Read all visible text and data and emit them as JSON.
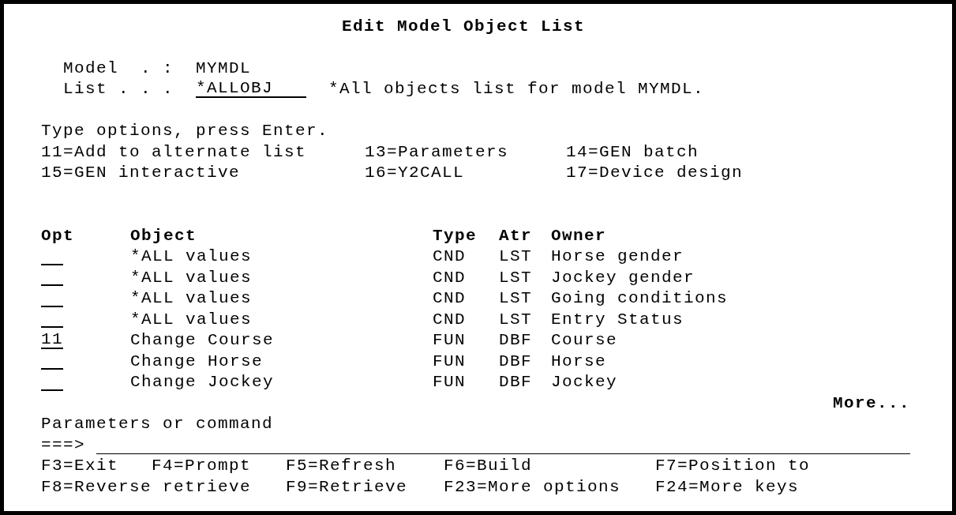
{
  "title": "Edit Model Object List",
  "header_fields": [
    {
      "kind": "output",
      "label": "Model  . :",
      "value": "MYMDL"
    },
    {
      "kind": "input",
      "label": "List . . .",
      "value": "*ALLOBJ",
      "description": "*All objects list for model MYMDL."
    }
  ],
  "instructions": "Type options, press Enter.",
  "options": [
    "11=Add to alternate list",
    "13=Parameters",
    "14=GEN batch",
    "15=GEN interactive",
    "16=Y2CALL",
    "17=Device design"
  ],
  "table": {
    "columns": [
      "Opt",
      "Object",
      "Type",
      "Atr",
      "Owner"
    ],
    "rows": [
      {
        "object": "*ALL values",
        "type": "CND",
        "atr": "LST",
        "owner": "Horse gender"
      },
      {
        "object": "*ALL values",
        "type": "CND",
        "atr": "LST",
        "owner": "Jockey gender"
      },
      {
        "object": "*ALL values",
        "type": "CND",
        "atr": "LST",
        "owner": "Going conditions"
      },
      {
        "object": "*ALL values",
        "type": "CND",
        "atr": "LST",
        "owner": "Entry Status"
      },
      {
        "opt": "11",
        "object": "Change Course",
        "type": "FUN",
        "atr": "DBF",
        "owner": "Course"
      },
      {
        "object": "Change Horse",
        "type": "FUN",
        "atr": "DBF",
        "owner": "Horse"
      },
      {
        "object": "Change Jockey",
        "type": "FUN",
        "atr": "DBF",
        "owner": "Jockey"
      }
    ]
  },
  "more_indicator": "More...",
  "command": {
    "label": "Parameters or command",
    "prompt": "===>"
  },
  "function_keys": [
    [
      "F3=Exit",
      "F4=Prompt",
      "F5=Refresh",
      "F6=Build",
      "F7=Position to"
    ],
    [
      "F8=Reverse retrieve",
      "F9=Retrieve",
      "F23=More options",
      "F24=More keys"
    ]
  ]
}
